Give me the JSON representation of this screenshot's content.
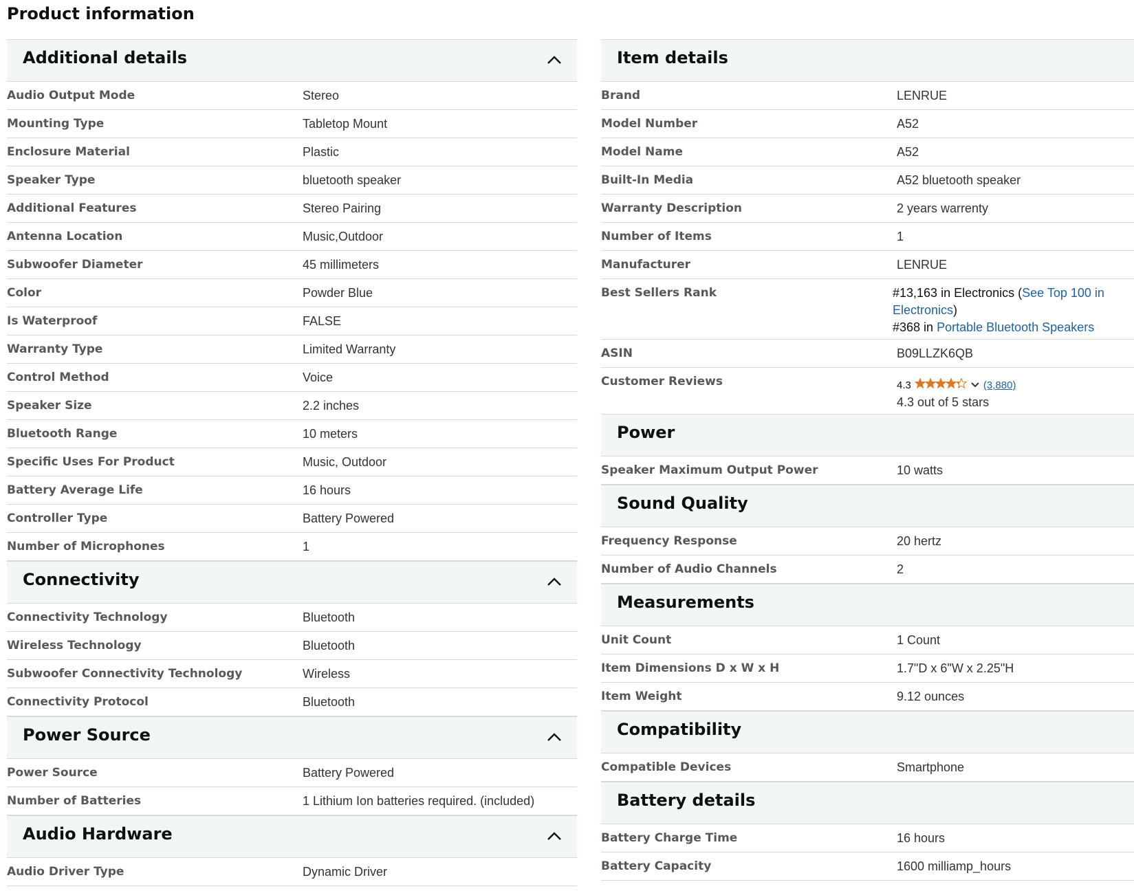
{
  "title": "Product information",
  "left": {
    "sections": [
      {
        "title": "Additional details",
        "rows": [
          {
            "k": "Audio Output Mode",
            "v": "Stereo"
          },
          {
            "k": "Mounting Type",
            "v": "Tabletop Mount"
          },
          {
            "k": "Enclosure Material",
            "v": "Plastic"
          },
          {
            "k": "Speaker Type",
            "v": "bluetooth speaker"
          },
          {
            "k": "Additional Features",
            "v": "Stereo Pairing"
          },
          {
            "k": "Antenna Location",
            "v": "Music,Outdoor"
          },
          {
            "k": "Subwoofer Diameter",
            "v": "45 millimeters"
          },
          {
            "k": "Color",
            "v": "Powder Blue"
          },
          {
            "k": "Is Waterproof",
            "v": "FALSE"
          },
          {
            "k": "Warranty Type",
            "v": "Limited Warranty"
          },
          {
            "k": "Control Method",
            "v": "Voice"
          },
          {
            "k": "Speaker Size",
            "v": "2.2 inches"
          },
          {
            "k": "Bluetooth Range",
            "v": "10 meters"
          },
          {
            "k": "Specific Uses For Product",
            "v": "Music, Outdoor"
          },
          {
            "k": "Battery Average Life",
            "v": "16 hours"
          },
          {
            "k": "Controller Type",
            "v": "Battery Powered"
          },
          {
            "k": "Number of Microphones",
            "v": "1"
          }
        ]
      },
      {
        "title": "Connectivity",
        "rows": [
          {
            "k": "Connectivity Technology",
            "v": "Bluetooth"
          },
          {
            "k": "Wireless Technology",
            "v": "Bluetooth"
          },
          {
            "k": "Subwoofer Connectivity Technology",
            "v": "Wireless"
          },
          {
            "k": "Connectivity Protocol",
            "v": "Bluetooth"
          }
        ]
      },
      {
        "title": "Power Source",
        "rows": [
          {
            "k": "Power Source",
            "v": "Battery Powered"
          },
          {
            "k": "Number of Batteries",
            "v": "1 Lithium Ion batteries required. (included)"
          }
        ]
      },
      {
        "title": "Audio Hardware",
        "rows": [
          {
            "k": "Audio Driver Type",
            "v": "Dynamic Driver"
          }
        ]
      }
    ]
  },
  "right": {
    "item_details": {
      "title": "Item details",
      "rows": [
        {
          "k": "Brand",
          "v": "LENRUE"
        },
        {
          "k": "Model Number",
          "v": "A52"
        },
        {
          "k": "Model Name",
          "v": "A52"
        },
        {
          "k": "Built-In Media",
          "v": "A52 bluetooth speaker"
        },
        {
          "k": "Warranty Description",
          "v": "2 years warrenty"
        },
        {
          "k": "Number of Items",
          "v": "1"
        },
        {
          "k": "Manufacturer",
          "v": "LENRUE"
        }
      ],
      "best_sellers": {
        "k": "Best Sellers Rank",
        "rank1": "#13,163 in Electronics (",
        "rank1_link": "See Top 100 in Electronics",
        "rank1_end": ")",
        "rank2": "#368 in ",
        "rank2_link": "Portable Bluetooth Speakers"
      },
      "asin": {
        "k": "ASIN",
        "v": "B09LLZK6QB"
      },
      "reviews": {
        "k": "Customer Reviews",
        "rating": "4.3",
        "rating_value": 4.3,
        "count": "(3,880)",
        "out_of": "4.3 out of 5 stars",
        "star_color": "#de7921"
      }
    },
    "power": {
      "title": "Power",
      "rows": [
        {
          "k": "Speaker Maximum Output Power",
          "v": "10 watts"
        }
      ]
    },
    "sound": {
      "title": "Sound Quality",
      "rows": [
        {
          "k": "Frequency Response",
          "v": "20 hertz"
        },
        {
          "k": "Number of Audio Channels",
          "v": "2"
        }
      ]
    },
    "measurements": {
      "title": "Measurements",
      "rows": [
        {
          "k": "Unit Count",
          "v": "1 Count"
        },
        {
          "k": "Item Dimensions D x W x H",
          "v": "1.7\"D x 6\"W x 2.25\"H"
        },
        {
          "k": "Item Weight",
          "v": "9.12 ounces"
        }
      ]
    },
    "compat": {
      "title": "Compatibility",
      "rows": [
        {
          "k": "Compatible Devices",
          "v": "Smartphone"
        }
      ]
    },
    "battery": {
      "title": "Battery details",
      "rows": [
        {
          "k": "Battery Charge Time",
          "v": "16 hours"
        },
        {
          "k": "Battery Capacity",
          "v": "1600 milliamp_hours"
        }
      ]
    }
  }
}
